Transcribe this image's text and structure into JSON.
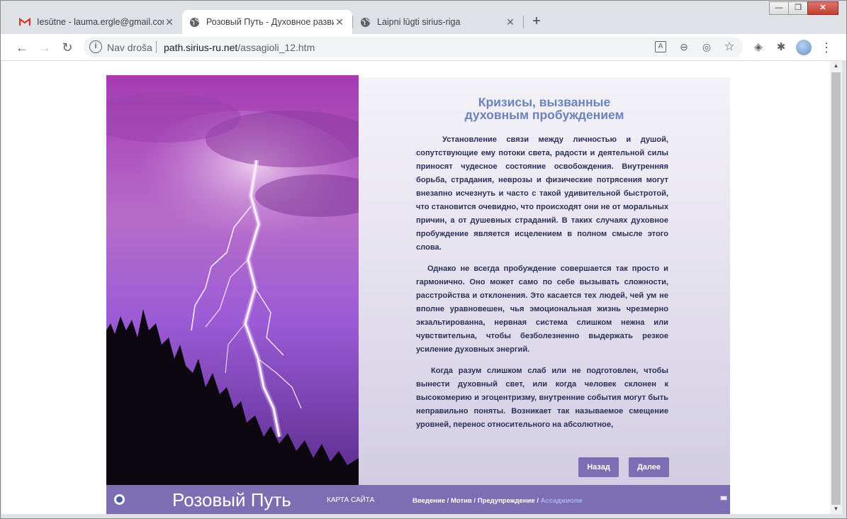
{
  "tabs": [
    {
      "title": "Iesūtne - lauma.ergle@gmail.com",
      "icon": "gmail-icon",
      "close": "✕"
    },
    {
      "title": "Розовый Путь - Духовное развитие",
      "icon": "globe-icon",
      "close": "✕"
    },
    {
      "title": "Laipni lūgti sirius-riga",
      "icon": "globe-icon",
      "close": "✕"
    }
  ],
  "new_tab": "+",
  "window_controls": {
    "minimize": "—",
    "maximize": "❐",
    "close": "✕"
  },
  "toolbar": {
    "back": "←",
    "forward": "→",
    "reload": "↻",
    "security_label": "Nav droša",
    "url_domain": "path.sirius-ru.net",
    "url_path": "/assagioli_12.htm",
    "translate_icon": "A",
    "zoom_icon": "⊖",
    "visibility_icon": "◎",
    "star_icon": "☆",
    "shield_icon": "◈",
    "extensions_icon": "✱",
    "menu_icon": "⋮"
  },
  "page": {
    "heading_line1": "Кризисы, вызванные",
    "heading_line2": "духовным пробуждением",
    "paragraphs": [
      "Установление связи между личностью и душой, сопутствующие ему потоки света, радости и деятельной силы приносят чудесное состояние освобождения. Внутренняя борьба, страдания, неврозы и физические потрясения могут внезапно исчезнуть и часто с такой удивительной быстротой, что становится очевидно, что происходят они не от моральных причин, а от душевных страданий. В таких случаях духовное пробуждение является исцелением в полном смысле этого слова.",
      "Однако не всегда пробуждение совершается так просто и гармонично. Оно может само по себе вызывать сложности, расстройства и отклонения. Это касается тех людей, чей ум не вполне уравновешен, чья эмоциональная жизнь чрезмерно экзальтированна, нервная система слишком нежна или чувствительна, чтобы безболезненно выдержать резкое усиление духовных энергий.",
      "Когда разум слишком слаб или не подготовлен, чтобы вынести духовный свет, или когда человек склонен к высокомерию и эгоцентризму, внутренние события могут быть неправильно поняты. Возникает так называемое смещение уровней, перенос относительного на абсолютное,"
    ],
    "back_button": "Назад",
    "next_button": "Далее"
  },
  "footer": {
    "brand": "Розовый Путь",
    "sitemap": "КАРТА САЙТА",
    "crumbs": [
      "Введение",
      "Мотив",
      "Предупреждение"
    ],
    "crumb_separator": " / ",
    "current_crumb": "Ассаджиоли"
  },
  "colors": {
    "accent": "#7d6db3",
    "heading": "#6b83b8",
    "text": "#2b3058"
  }
}
